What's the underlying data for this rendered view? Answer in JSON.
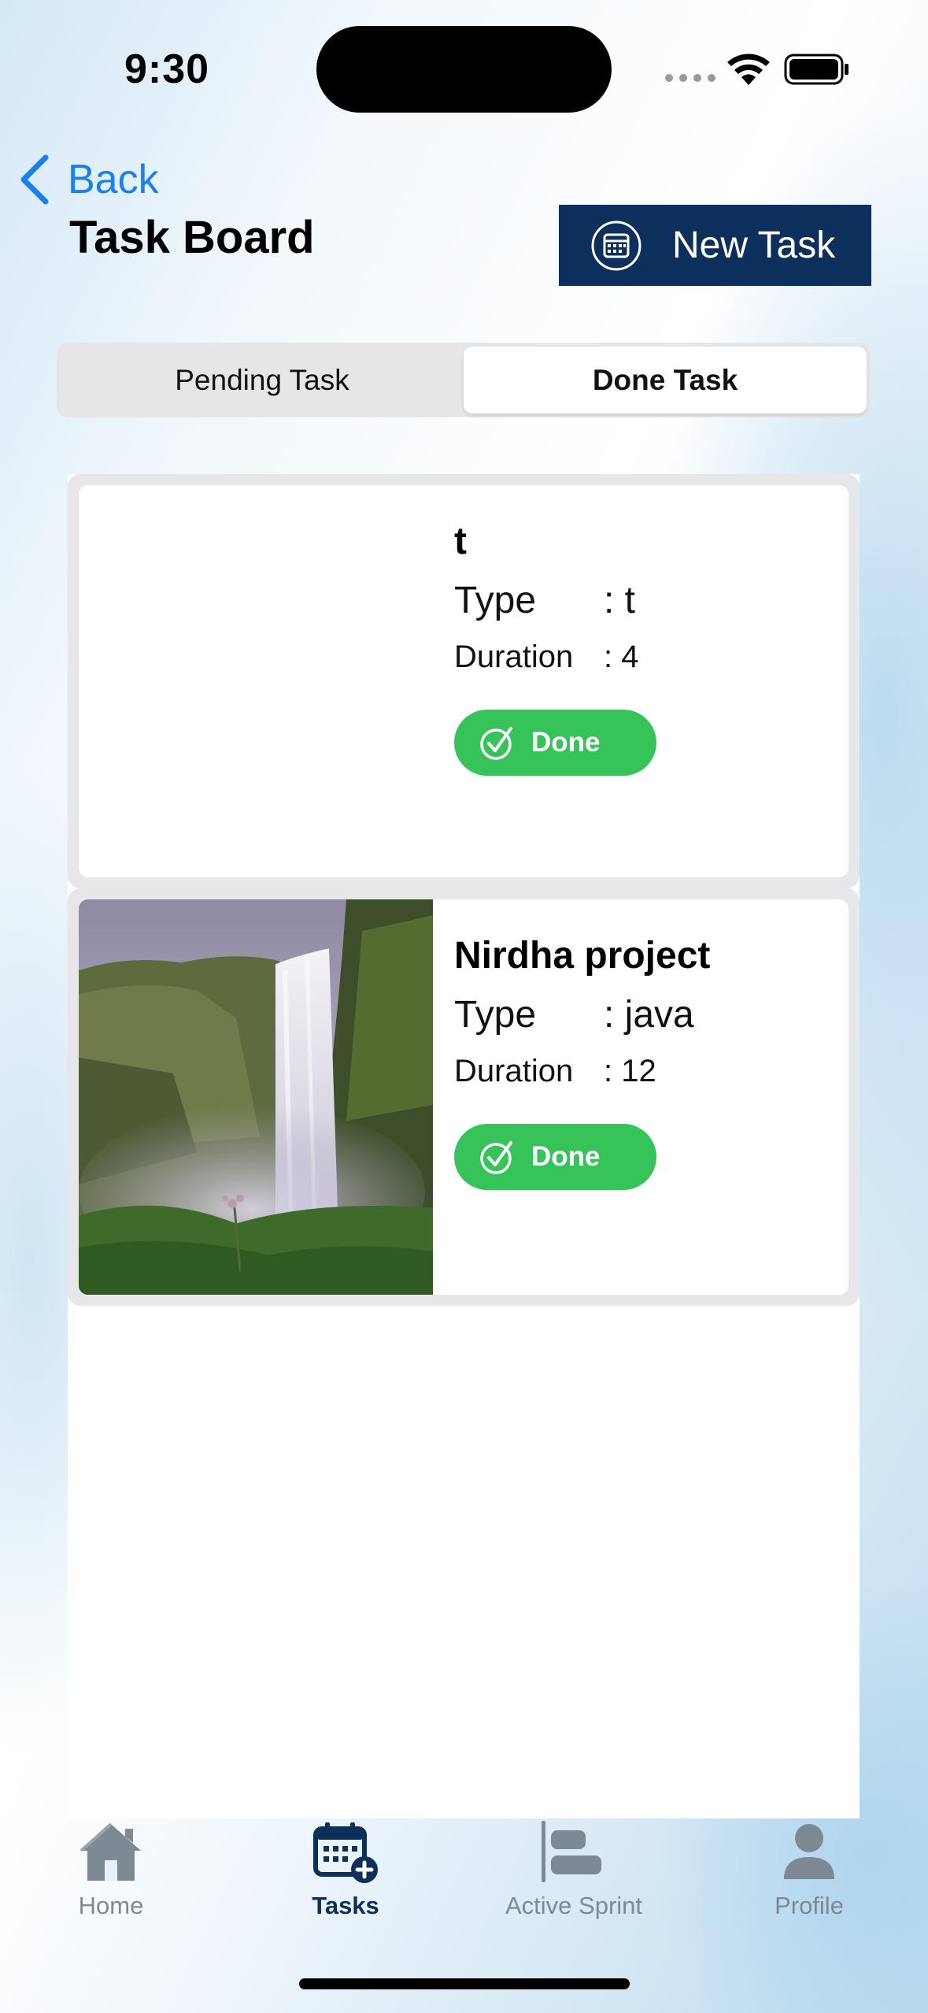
{
  "status_bar": {
    "time": "9:30"
  },
  "header": {
    "back_label": "Back",
    "title": "Task Board",
    "new_task_label": "New Task"
  },
  "segments": [
    {
      "label": "Pending Task",
      "active": false
    },
    {
      "label": "Done Task",
      "active": true
    }
  ],
  "tasks": [
    {
      "title": "t",
      "type_label": "Type",
      "type_value": ": t",
      "duration_label": "Duration",
      "duration_value": ": 4",
      "status_button": "Done",
      "has_image": false
    },
    {
      "title": "Nirdha project",
      "type_label": "Type",
      "type_value": ": java",
      "duration_label": "Duration",
      "duration_value": ": 12",
      "status_button": "Done",
      "has_image": true,
      "image_icon": "waterfall-photo"
    }
  ],
  "tabbar": {
    "items": [
      {
        "label": "Home",
        "icon": "house-icon",
        "active": false
      },
      {
        "label": "Tasks",
        "icon": "calendar-plus-icon",
        "active": true
      },
      {
        "label": "Active Sprint",
        "icon": "gantt-icon",
        "active": false
      },
      {
        "label": "Profile",
        "icon": "person-icon",
        "active": false
      }
    ]
  },
  "colors": {
    "accent_blue": "#1a7ff0",
    "navy": "#0d2f5b",
    "done_green": "#36c45a",
    "tab_inactive": "#7d8a94"
  }
}
